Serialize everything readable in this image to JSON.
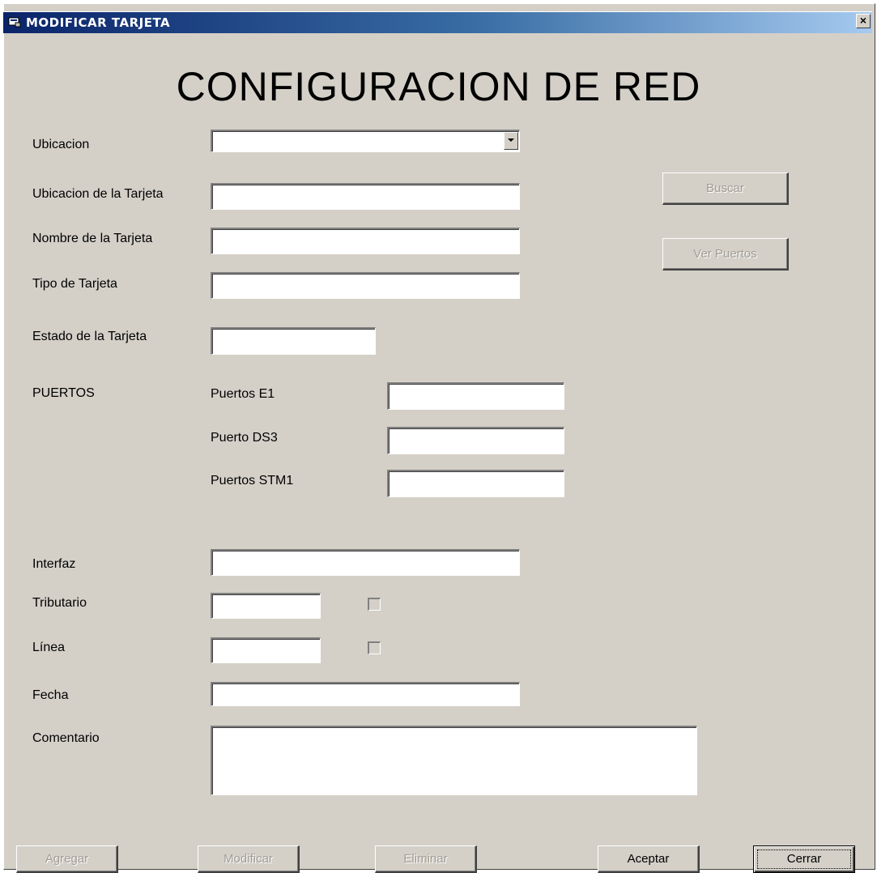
{
  "window": {
    "title": "MODIFICAR TARJETA",
    "close_glyph": "×"
  },
  "heading": "CONFIGURACION DE RED",
  "labels": {
    "ubicacion": "Ubicacion",
    "ubicacion_tarjeta": "Ubicacion de la Tarjeta",
    "nombre_tarjeta": "Nombre de la Tarjeta",
    "tipo_tarjeta": "Tipo de Tarjeta",
    "estado_tarjeta": "Estado de la Tarjeta",
    "puertos": "PUERTOS",
    "puertos_e1": "Puertos E1",
    "puerto_ds3": "Puerto DS3",
    "puertos_stm1": "Puertos STM1",
    "interfaz": "Interfaz",
    "tributario": "Tributario",
    "linea": "Línea",
    "fecha": "Fecha",
    "comentario": "Comentario"
  },
  "fields": {
    "ubicacion": "",
    "ubicacion_tarjeta": "",
    "nombre_tarjeta": "",
    "tipo_tarjeta": "",
    "estado_tarjeta": "",
    "puertos_e1": "",
    "puerto_ds3": "",
    "puertos_stm1": "",
    "interfaz": "",
    "tributario": "",
    "linea": "",
    "fecha": "",
    "comentario": ""
  },
  "checkboxes": {
    "tributario_checked": false,
    "linea_checked": false
  },
  "buttons": {
    "buscar": "Buscar",
    "ver_puertos": "Ver Puertos",
    "agregar": "Agregar",
    "modificar": "Modificar",
    "eliminar": "Eliminar",
    "aceptar": "Aceptar",
    "cerrar": "Cerrar"
  },
  "colors": {
    "face": "#d4d0c8",
    "title_start": "#0a246a",
    "title_end": "#a6caf0",
    "disabled_text": "#a09c94"
  }
}
